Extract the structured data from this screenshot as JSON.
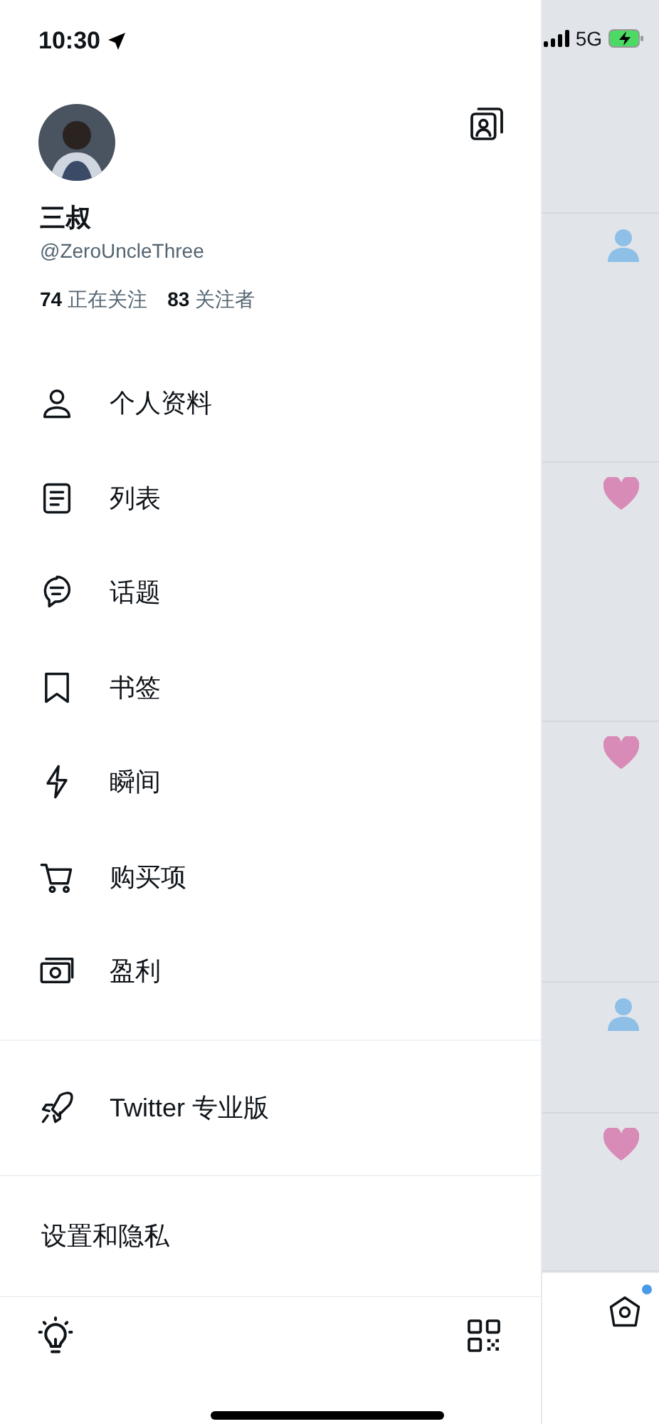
{
  "status_bar": {
    "time": "10:30",
    "network": "5G"
  },
  "profile": {
    "name": "三叔",
    "handle": "@ZeroUncleThree",
    "following_count": "74",
    "following_label": "正在关注",
    "followers_count": "83",
    "followers_label": "关注者"
  },
  "menu": [
    {
      "label": "个人资料"
    },
    {
      "label": "列表"
    },
    {
      "label": "话题"
    },
    {
      "label": "书签"
    },
    {
      "label": "瞬间"
    },
    {
      "label": "购买项"
    },
    {
      "label": "盈利"
    }
  ],
  "pro_item": {
    "label": "Twitter 专业版"
  },
  "settings_item": {
    "label": "设置和隐私"
  },
  "notifications": [
    {
      "kind": "follow"
    },
    {
      "kind": "like"
    },
    {
      "kind": "like"
    },
    {
      "kind": "follow"
    },
    {
      "kind": "like"
    }
  ],
  "home_tab": {
    "unread": true
  }
}
